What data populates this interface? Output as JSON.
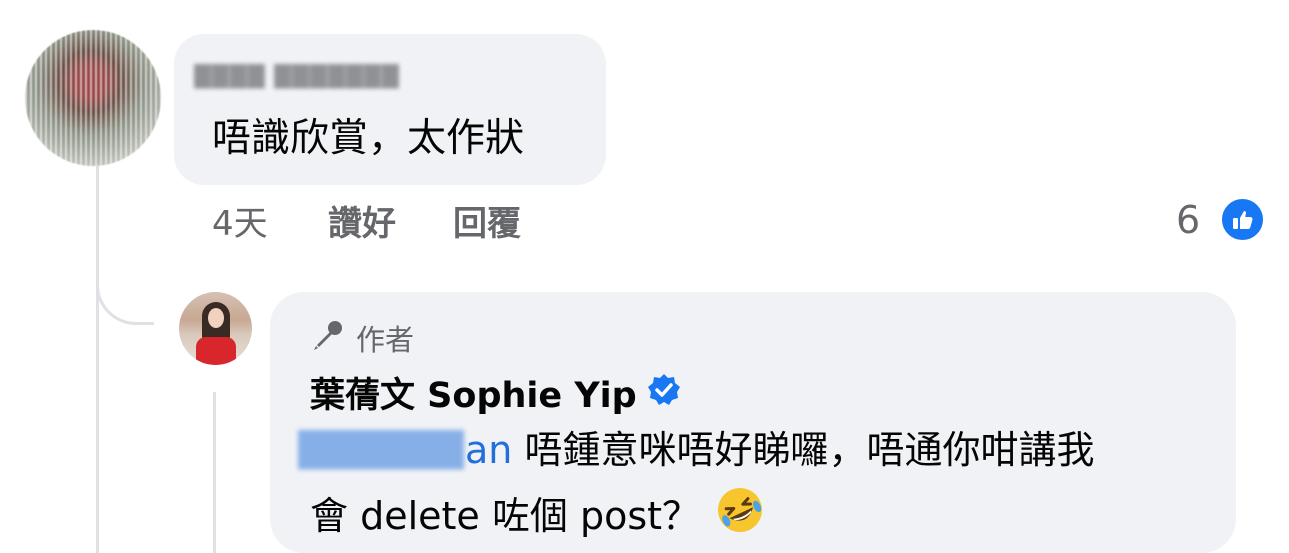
{
  "comment": {
    "author_name": "████ ███████",
    "text": "唔識欣賞，太作狀",
    "time": "4天",
    "like_label": "讚好",
    "reply_label": "回覆",
    "like_count": "6"
  },
  "reply": {
    "badge_label": "作者",
    "author_name": "葉蒨文 Sophie Yip",
    "mention_hidden": "████████",
    "mention_tail": "an",
    "text_line1": " 唔鍾意咪唔好睇囉，唔通你咁講我",
    "text_line2": "會 delete 咗個 post？",
    "emoji": "rolling-on-floor-laughing"
  },
  "colors": {
    "bubble": "#f0f2f5",
    "accent_blue": "#1877f2",
    "mention_blue": "#216fdb",
    "secondary_text": "#65676b",
    "thread_line": "#dfe1e5"
  }
}
